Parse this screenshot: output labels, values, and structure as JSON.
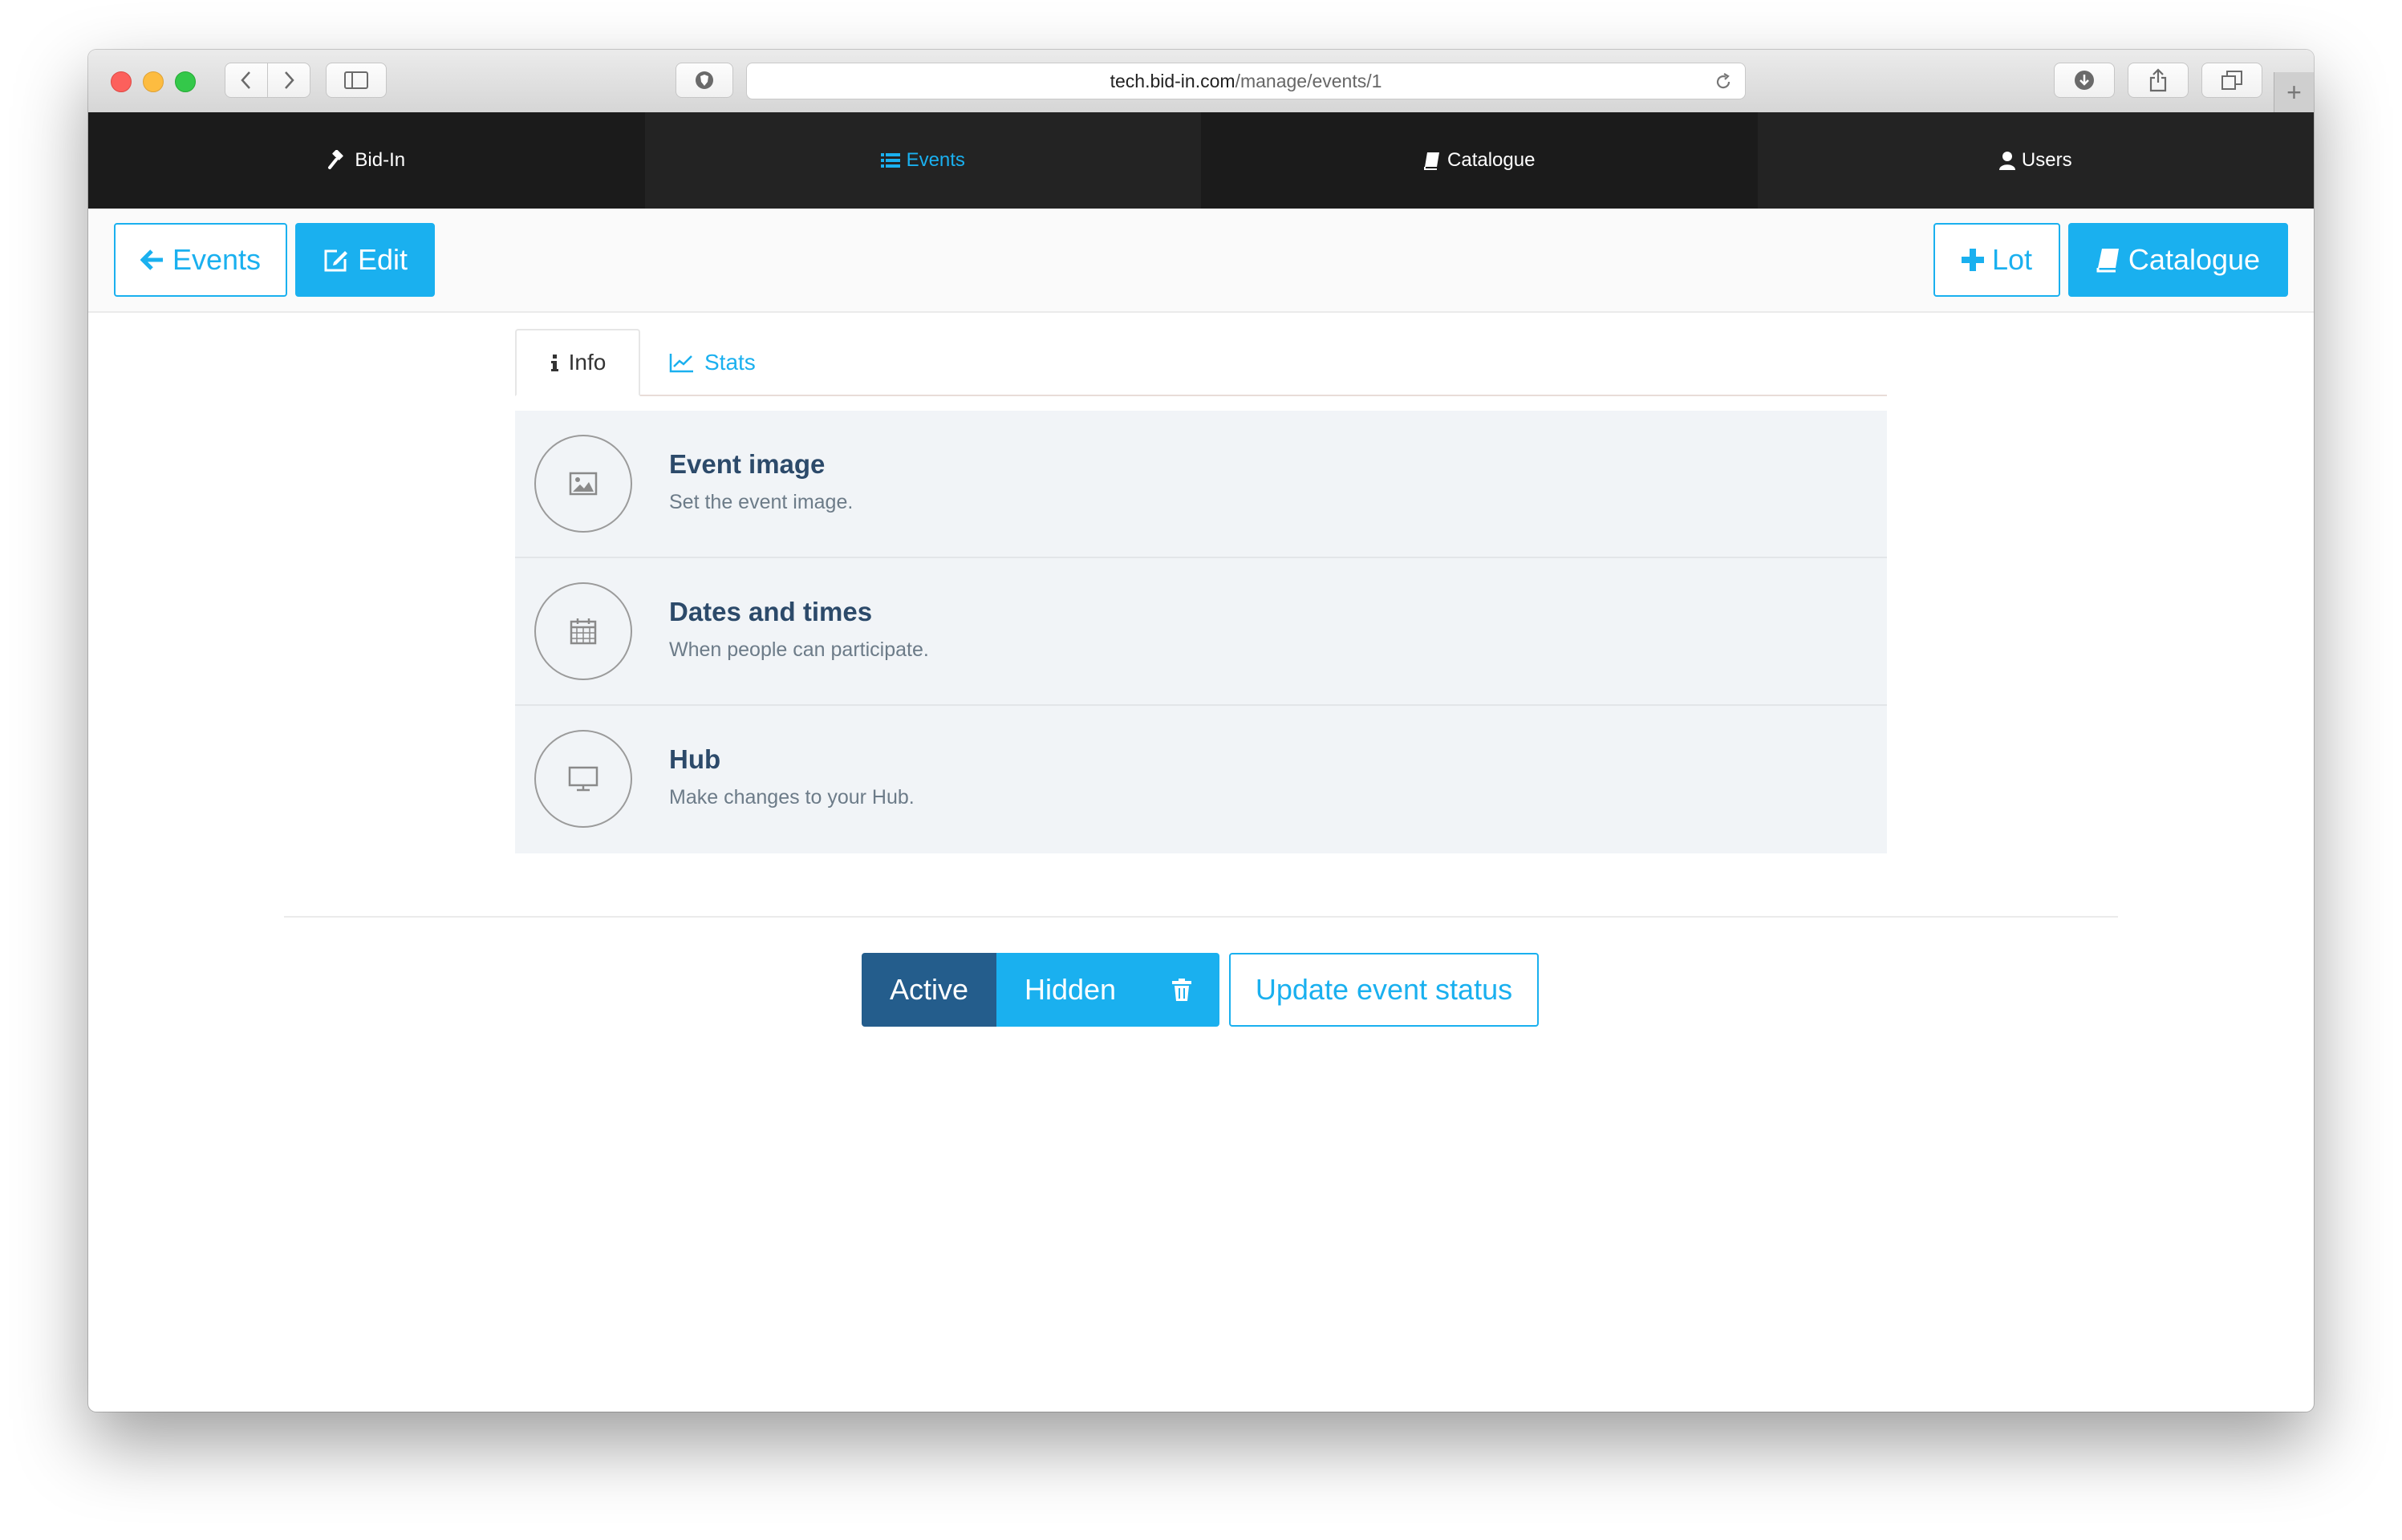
{
  "browser": {
    "url_host": "tech.bid-in.com",
    "url_path": "/manage/events/1"
  },
  "nav": {
    "items": [
      {
        "label": "Bid-In",
        "icon": "gavel-icon"
      },
      {
        "label": "Events",
        "icon": "list-icon",
        "active": true
      },
      {
        "label": "Catalogue",
        "icon": "book-icon"
      },
      {
        "label": "Users",
        "icon": "user-icon"
      }
    ]
  },
  "toolbar": {
    "back_label": "Events",
    "edit_label": "Edit",
    "add_lot_label": "Lot",
    "catalogue_label": "Catalogue"
  },
  "tabs": [
    {
      "label": "Info",
      "icon": "info-icon",
      "active": true
    },
    {
      "label": "Stats",
      "icon": "line-chart-icon"
    }
  ],
  "settings": [
    {
      "title": "Event image",
      "subtitle": "Set the event image.",
      "icon": "image-icon"
    },
    {
      "title": "Dates and times",
      "subtitle": "When people can participate.",
      "icon": "calendar-icon"
    },
    {
      "title": "Hub",
      "subtitle": "Make changes to your Hub.",
      "icon": "monitor-icon"
    }
  ],
  "status": {
    "options": [
      "Active",
      "Hidden"
    ],
    "selected": "Active",
    "update_label": "Update event status"
  },
  "colors": {
    "accent": "#1ab0ef",
    "active_status": "#245d8c",
    "nav_bg": "#1f1f1f",
    "row_bg": "#f1f4f7",
    "title_text": "#2c4a6a"
  }
}
